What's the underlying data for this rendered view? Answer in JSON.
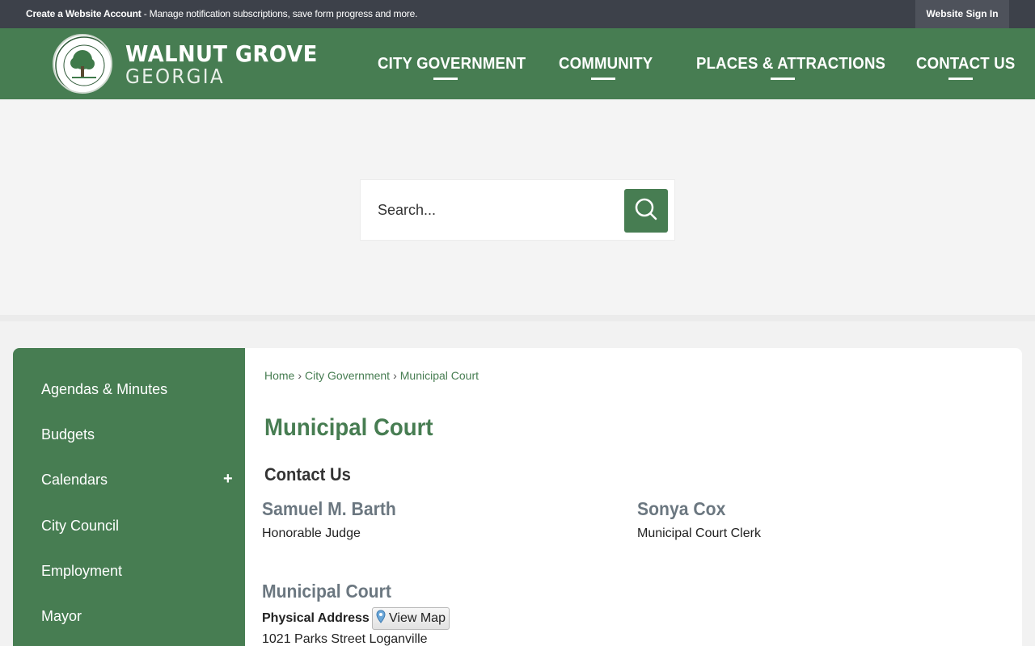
{
  "topbar": {
    "account_link": "Create a Website Account",
    "account_desc": " - Manage notification subscriptions, save form progress and more.",
    "signin_label": "Website Sign In"
  },
  "header": {
    "logo_title": "WALNUT GROVE",
    "logo_subtitle": "GEORGIA",
    "nav": [
      {
        "label": "CITY GOVERNMENT"
      },
      {
        "label": "COMMUNITY"
      },
      {
        "label": "PLACES & ATTRACTIONS"
      },
      {
        "label": "CONTACT US"
      }
    ]
  },
  "search": {
    "placeholder": "Search...",
    "icon": "search-icon"
  },
  "sidebar": {
    "items": [
      {
        "label": "Agendas & Minutes"
      },
      {
        "label": "Budgets"
      },
      {
        "label": "Calendars",
        "expand": "+"
      },
      {
        "label": "City Council"
      },
      {
        "label": "Employment"
      },
      {
        "label": "Mayor"
      }
    ]
  },
  "breadcrumb": {
    "items": [
      "Home",
      "City Government",
      "Municipal Court"
    ],
    "separator": "›"
  },
  "main": {
    "title": "Municipal Court",
    "section_title": "Contact Us",
    "contacts": [
      {
        "name": "Samuel M. Barth",
        "role": "Honorable Judge"
      },
      {
        "name": "Sonya Cox",
        "role": "Municipal Court Clerk"
      }
    ],
    "office": {
      "name": "Municipal Court",
      "address_label": "Physical Address",
      "view_map_label": "View Map",
      "address_line1": "1021 Parks Street Loganville"
    }
  },
  "colors": {
    "brand_green": "#477d52",
    "topbar": "#3d414a",
    "name_gray": "#6b7780"
  }
}
